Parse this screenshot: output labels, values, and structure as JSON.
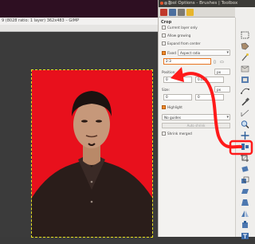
{
  "canvas": {
    "status_text": "9 (8028 ratio: 1 layer) 362x483 – GIMP"
  },
  "dock": {
    "title": "Tool Options - Brushes | Toolbox",
    "options": {
      "section_title": "Crop",
      "current_layer_only": "Current layer only",
      "allow_growing": "Allow growing",
      "expand_from_center": "Expand from center",
      "fixed_label": "Fixed",
      "fixed_mode": "Aspect ratio",
      "ratio_value": "2:3",
      "position_label": "Position:",
      "position_unit": "px",
      "position_x": "0",
      "position_y": "0.000",
      "size_label": "Size:",
      "size_unit": "px",
      "size_w": "0",
      "size_h": "0",
      "highlight_label": "Highlight",
      "guides_value": "No guides",
      "auto_shrink": "Auto shrink",
      "shrink_merged": "Shrink merged"
    }
  },
  "colors": {
    "photo_bg": "#e8101c",
    "highlight_orange": "#f08a2a",
    "annotation_red": "#ff1a1a"
  }
}
